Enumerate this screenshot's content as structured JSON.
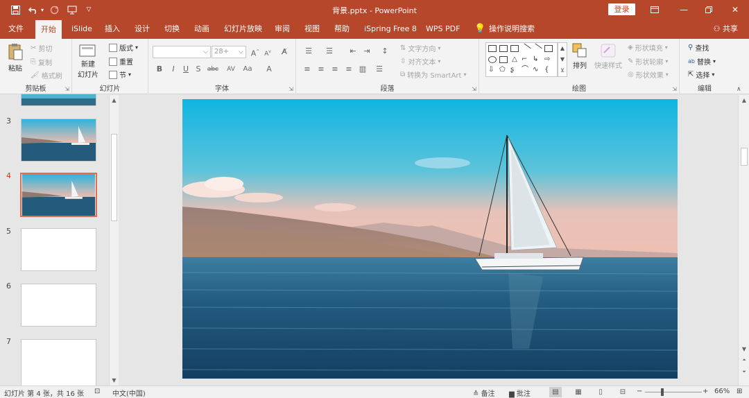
{
  "title_bar": {
    "document_title": "背景.pptx - PowerPoint",
    "login_label": "登录",
    "quick_access": [
      "save-icon",
      "undo-icon",
      "redo-icon",
      "present-icon",
      "customize-icon"
    ]
  },
  "tabs": [
    {
      "label": "文件"
    },
    {
      "label": "开始"
    },
    {
      "label": "iSlide"
    },
    {
      "label": "插入"
    },
    {
      "label": "设计"
    },
    {
      "label": "切换"
    },
    {
      "label": "动画"
    },
    {
      "label": "幻灯片放映"
    },
    {
      "label": "审阅"
    },
    {
      "label": "视图"
    },
    {
      "label": "帮助"
    },
    {
      "label": "iSpring Free 8"
    },
    {
      "label": "WPS PDF"
    },
    {
      "label": "操作说明搜索"
    }
  ],
  "share_label": "共享",
  "ribbon": {
    "clipboard": {
      "label": "剪贴板",
      "paste": "粘贴",
      "cut": "剪切",
      "copy": "复制",
      "format_painter": "格式刷"
    },
    "slides": {
      "label": "幻灯片",
      "new_slide": "新建",
      "new_slide_2": "幻灯片",
      "layout": "版式",
      "reset": "重置",
      "section": "节"
    },
    "font": {
      "label": "字体",
      "font_size": "28+",
      "buttons": [
        "B",
        "I",
        "U",
        "S",
        "abc",
        "AV",
        "Aa",
        "A"
      ]
    },
    "paragraph": {
      "label": "段落",
      "text_direction": "文字方向",
      "align_text": "对齐文本",
      "convert_smartart": "转换为 SmartArt"
    },
    "drawing": {
      "label": "绘图",
      "arrange": "排列",
      "quick_styles": "快速样式",
      "shape_fill": "形状填充",
      "shape_outline": "形状轮廓",
      "shape_effects": "形状效果"
    },
    "editing": {
      "label": "编辑",
      "find": "查找",
      "replace": "替换",
      "select": "选择"
    }
  },
  "thumbnails": [
    {
      "number": "",
      "type": "photo",
      "active": false
    },
    {
      "number": "3",
      "type": "photo",
      "active": false
    },
    {
      "number": "4",
      "type": "photo",
      "active": true
    },
    {
      "number": "5",
      "type": "blank",
      "active": false
    },
    {
      "number": "6",
      "type": "blank",
      "active": false
    },
    {
      "number": "7",
      "type": "blank",
      "active": false
    }
  ],
  "status_bar": {
    "slide_info": "幻灯片 第 4 张，共 16 张",
    "language": "中文(中国)",
    "notes": "备注",
    "comments": "批注",
    "zoom": "66%"
  },
  "colors": {
    "accent": "#b7472a",
    "active_thumb_border": "#e46c4e"
  }
}
